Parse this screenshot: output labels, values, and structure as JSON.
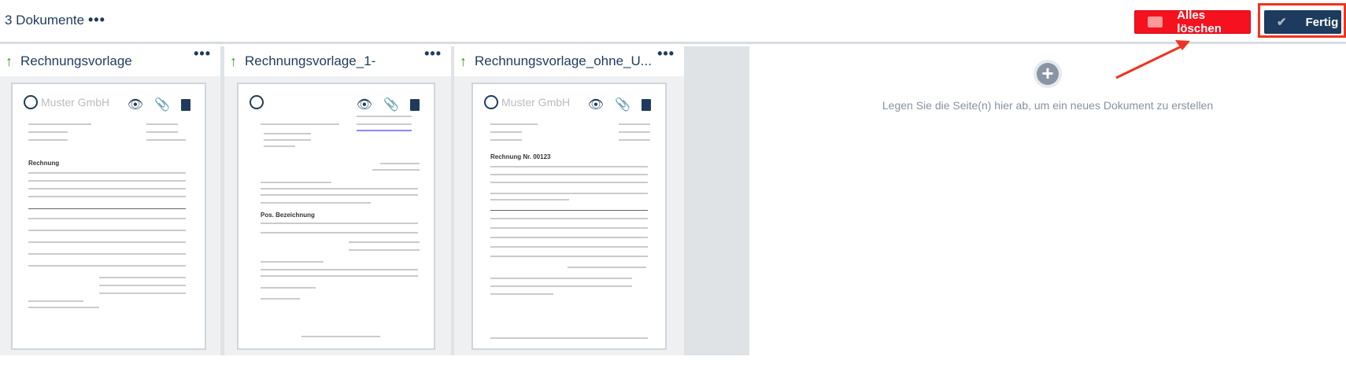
{
  "header": {
    "title": "3 Dokumente",
    "more_icon": "more-horizontal-icon",
    "delete_all_label": "Alles löschen",
    "done_label": "Fertig"
  },
  "colors": {
    "delete": "#f5111d",
    "done": "#1d3b5e",
    "highlight": "#f0331f",
    "arrow_up": "#3a9a1e"
  },
  "documents": [
    {
      "name": "Rechnungsvorlage",
      "logo_text": "Muster GmbH",
      "heading": "Rechnung"
    },
    {
      "name": "Rechnungsvorlage_1-",
      "logo_text": "",
      "heading": "Pos.   Bezeichnung"
    },
    {
      "name": "Rechnungsvorlage_ohne_U...",
      "logo_text": "Muster GmbH",
      "heading": "Rechnung Nr. 00123"
    }
  ],
  "dropzone": {
    "text": "Legen Sie die Seite(n) hier ab, um ein neues Dokument zu erstellen"
  }
}
